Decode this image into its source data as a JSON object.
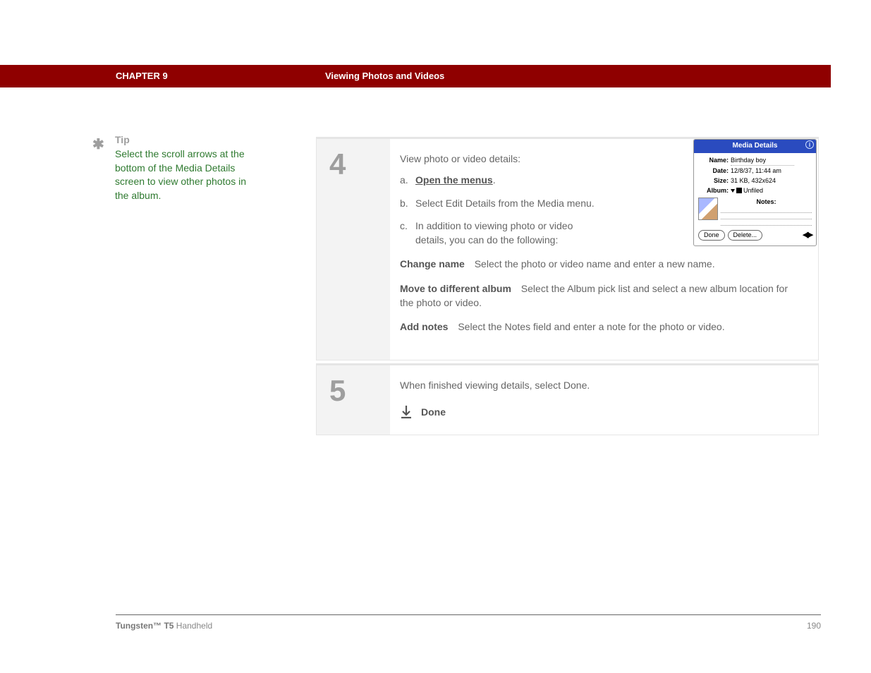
{
  "header": {
    "chapter": "CHAPTER 9",
    "title": "Viewing Photos and Videos"
  },
  "tip": {
    "label": "Tip",
    "body": "Select the scroll arrows at the bottom of the Media Details screen to view other photos in the album."
  },
  "steps": {
    "s4": {
      "num": "4",
      "intro": "View photo or video details:",
      "a_letter": "a.",
      "a_text": "Open the menus",
      "a_after": ".",
      "b_letter": "b.",
      "b_text": "Select Edit Details from the Media menu.",
      "c_letter": "c.",
      "c_text": "In addition to viewing photo or video details, you can do the following:",
      "def_change_name_t": "Change name",
      "def_change_name_d": "Select the photo or video name and enter a new name.",
      "def_move_album_t": "Move to different album",
      "def_move_album_d": "Select the Album pick list and select a new album location for the photo or video.",
      "def_add_notes_t": "Add notes",
      "def_add_notes_d": "Select the Notes field and enter a note for the photo or video."
    },
    "s5": {
      "num": "5",
      "body": "When finished viewing details, select Done.",
      "done": "Done"
    }
  },
  "details_dialog": {
    "title": "Media Details",
    "name_k": "Name:",
    "name_v": "Birthday boy",
    "date_k": "Date:",
    "date_v": "12/8/37, 11:44 am",
    "size_k": "Size:",
    "size_v": "31 KB, 432x624",
    "album_k": "Album:",
    "album_v": "Unfiled",
    "notes_label": "Notes:",
    "done_btn": "Done",
    "delete_btn": "Delete..."
  },
  "footer": {
    "product_b": "Tungsten™ T5",
    "product_r": " Handheld",
    "page": "190"
  }
}
